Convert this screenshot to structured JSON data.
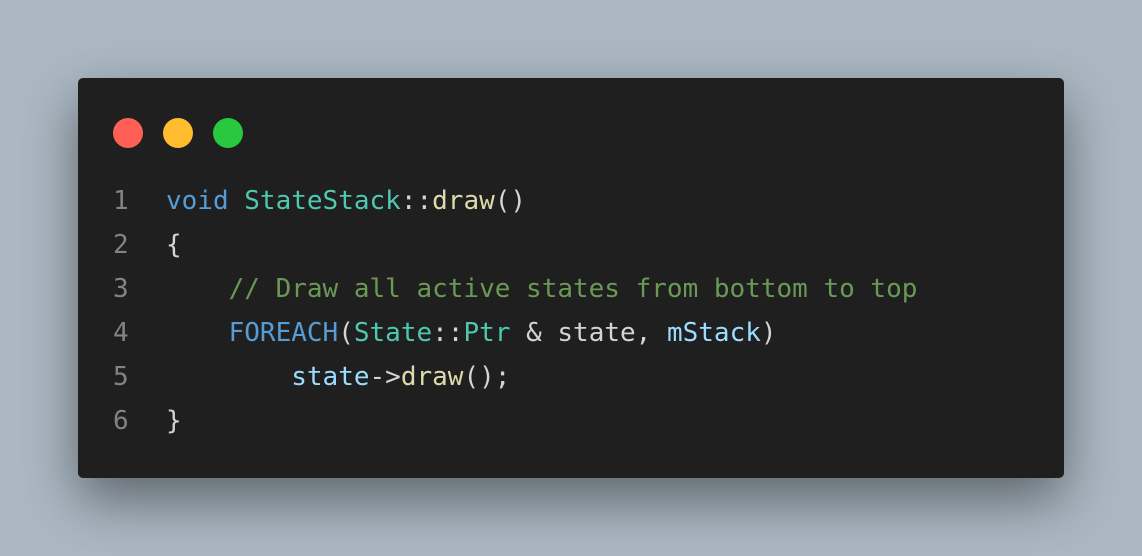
{
  "window_controls": [
    {
      "name": "close",
      "color": "#ff5f57"
    },
    {
      "name": "minimize",
      "color": "#febc2e"
    },
    {
      "name": "maximize",
      "color": "#28c840"
    }
  ],
  "lines": [
    {
      "num": "1",
      "indent": "",
      "tokens": [
        {
          "text": "void",
          "type": "keyword"
        },
        {
          "text": " ",
          "type": "plain"
        },
        {
          "text": "StateStack",
          "type": "type"
        },
        {
          "text": "::",
          "type": "plain"
        },
        {
          "text": "draw",
          "type": "func"
        },
        {
          "text": "()",
          "type": "plain"
        }
      ]
    },
    {
      "num": "2",
      "indent": "",
      "tokens": [
        {
          "text": "{",
          "type": "plain"
        }
      ]
    },
    {
      "num": "3",
      "indent": "    ",
      "tokens": [
        {
          "text": "// Draw all active states from bottom to top",
          "type": "comment"
        }
      ]
    },
    {
      "num": "4",
      "indent": "    ",
      "tokens": [
        {
          "text": "FOREACH",
          "type": "keyword"
        },
        {
          "text": "(",
          "type": "plain"
        },
        {
          "text": "State",
          "type": "type"
        },
        {
          "text": "::",
          "type": "plain"
        },
        {
          "text": "Ptr",
          "type": "type"
        },
        {
          "text": " & state, ",
          "type": "plain"
        },
        {
          "text": "mStack",
          "type": "var"
        },
        {
          "text": ")",
          "type": "plain"
        }
      ]
    },
    {
      "num": "5",
      "indent": "        ",
      "tokens": [
        {
          "text": "state",
          "type": "var"
        },
        {
          "text": "->",
          "type": "plain"
        },
        {
          "text": "draw",
          "type": "func"
        },
        {
          "text": "();",
          "type": "plain"
        }
      ]
    },
    {
      "num": "6",
      "indent": "",
      "tokens": [
        {
          "text": "}",
          "type": "plain"
        }
      ]
    }
  ]
}
